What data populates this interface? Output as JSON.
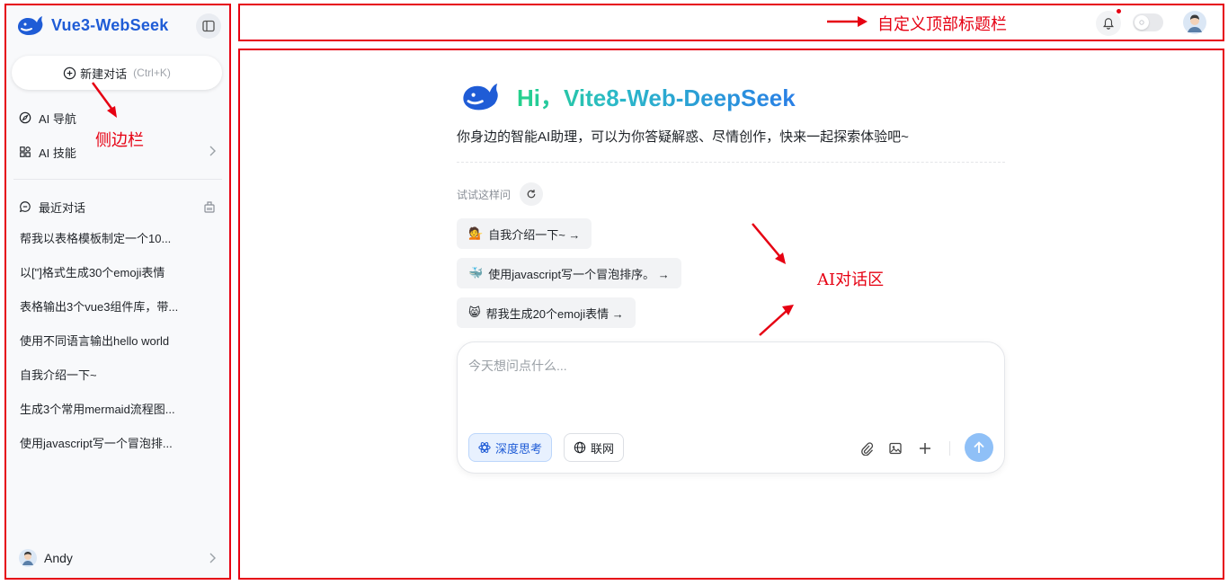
{
  "sidebar": {
    "brand": "Vue3-WebSeek",
    "new_chat_label": "新建对话",
    "new_chat_shortcut": "(Ctrl+K)",
    "nav": [
      {
        "label": "AI 导航",
        "icon": "compass-icon"
      },
      {
        "label": "AI 技能",
        "icon": "apps-icon"
      }
    ],
    "recent_label": "最近对话",
    "conversations": [
      "帮我以表格模板制定一个10...",
      "以[\"]格式生成30个emoji表情",
      "表格输出3个vue3组件库，带...",
      "使用不同语言输出hello world",
      "自我介绍一下~",
      "生成3个常用mermaid流程图...",
      "使用javascript写一个冒泡排..."
    ],
    "user_name": "Andy"
  },
  "annotations": {
    "header_note": "自定义顶部标题栏",
    "sidebar_note": "侧边栏",
    "ai_note": "AI对话区",
    "color": "#e60012"
  },
  "main": {
    "title": "Hi，Vite8-Web-DeepSeek",
    "subtitle": "你身边的智能AI助理，可以为你答疑解惑、尽情创作，快来一起探索体验吧~",
    "try_label": "试试这样问",
    "suggestions": [
      {
        "emoji": "💁",
        "label": "自我介绍一下~ →"
      },
      {
        "emoji": "🐳",
        "label": "使用javascript写一个冒泡排序。 →"
      },
      {
        "emoji": "😸",
        "label": "帮我生成20个emoji表情 →"
      }
    ],
    "composer": {
      "placeholder": "今天想问点什么...",
      "deep_think_label": "深度思考",
      "web_label": "联网"
    }
  },
  "colors": {
    "brand": "#1f5cd6",
    "send": "#8fc0f7"
  }
}
